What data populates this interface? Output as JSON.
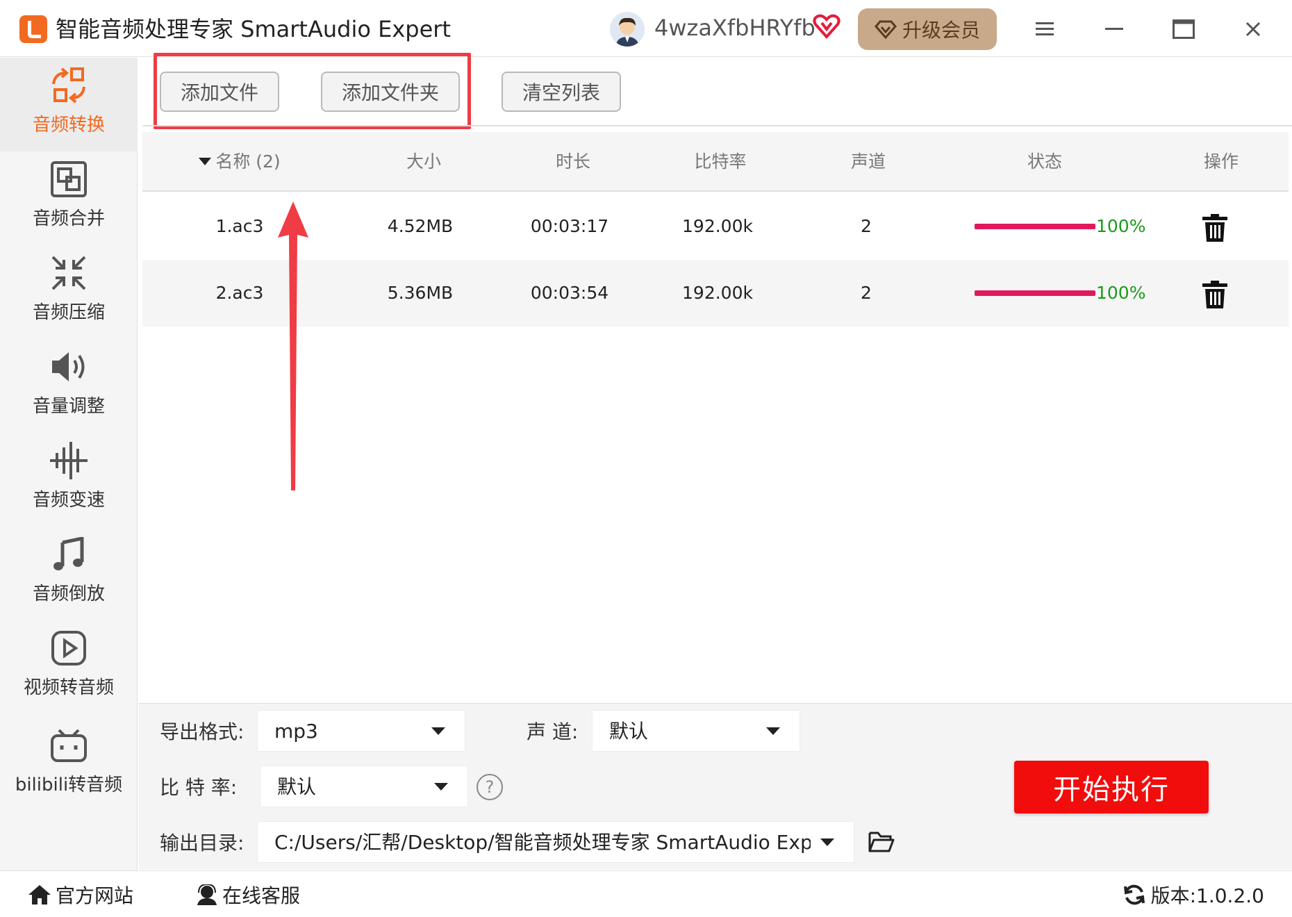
{
  "titlebar": {
    "app_title": "智能音频处理专家 SmartAudio Expert",
    "user_name": "4wzaXfbHRYfb",
    "upgrade_label": "升级会员"
  },
  "sidebar": {
    "items": [
      {
        "label": "音频转换",
        "icon": "convert-icon",
        "active": true
      },
      {
        "label": "音频合并",
        "icon": "merge-icon"
      },
      {
        "label": "音频压缩",
        "icon": "compress-icon"
      },
      {
        "label": "音量调整",
        "icon": "volume-icon"
      },
      {
        "label": "音频变速",
        "icon": "speed-icon"
      },
      {
        "label": "音频倒放",
        "icon": "music-note-icon"
      },
      {
        "label": "视频转音频",
        "icon": "play-icon"
      },
      {
        "label": "bilibili转音频",
        "icon": "bilibili-icon"
      }
    ]
  },
  "toolbar": {
    "add_file": "添加文件",
    "add_folder": "添加文件夹",
    "clear_list": "清空列表"
  },
  "table": {
    "headers": {
      "name": "名称 (2)",
      "size": "大小",
      "duration": "时长",
      "bitrate": "比特率",
      "channels": "声道",
      "status": "状态",
      "action": "操作"
    },
    "rows": [
      {
        "name": "1.ac3",
        "size": "4.52MB",
        "duration": "00:03:17",
        "bitrate": "192.00k",
        "channels": "2",
        "progress": 1.0,
        "progress_text": "100%"
      },
      {
        "name": "2.ac3",
        "size": "5.36MB",
        "duration": "00:03:54",
        "bitrate": "192.00k",
        "channels": "2",
        "progress": 1.0,
        "progress_text": "100%"
      }
    ]
  },
  "settings": {
    "format_label": "导出格式:",
    "format_value": "mp3",
    "channel_label": "声 道:",
    "channel_value": "默认",
    "bitrate_label": "比 特 率:",
    "bitrate_value": "默认",
    "output_label": "输出目录:",
    "output_value": "C:/Users/汇帮/Desktop/智能音频处理专家 SmartAudio Exp",
    "start_label": "开始执行"
  },
  "statusbar": {
    "website": "官方网站",
    "support": "在线客服",
    "version": "版本:1.0.2.0"
  },
  "colors": {
    "accent": "#f26a21",
    "start_button": "#f20d0d",
    "progress": "#e0195a",
    "progress_text": "#1a9a1a",
    "highlight": "#ef3c45",
    "upgrade_bg": "#c8a989"
  }
}
